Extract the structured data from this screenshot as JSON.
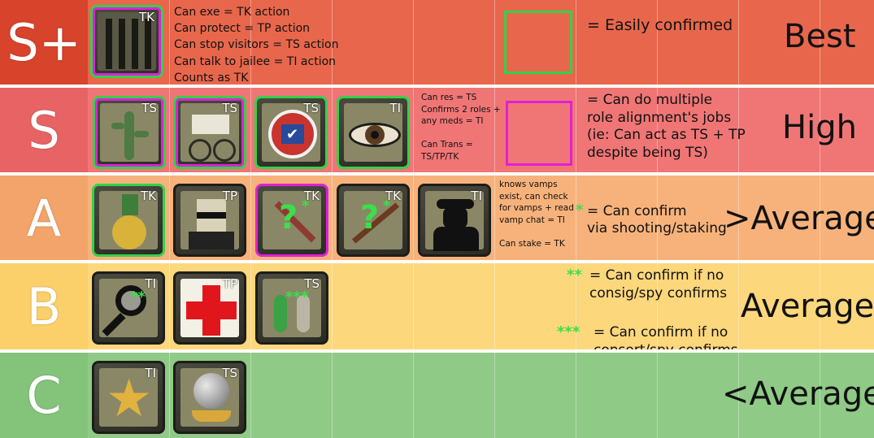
{
  "tiers": [
    {
      "label": "S+",
      "color": "#e8674c",
      "tier_bg": "#d8432b",
      "rank": "Best",
      "icons": [
        {
          "name": "jailor-icon",
          "tag": "TK",
          "border": "gm"
        }
      ],
      "notes": [
        "Can exe = TK action",
        "Can protect = TP action",
        "Can stop visitors = TS action",
        "Can talk to jailee = TI action",
        "Counts as TK"
      ]
    },
    {
      "label": "S",
      "color": "#f07676",
      "tier_bg": "#e86464",
      "rank": "High",
      "icons": [
        {
          "name": "cactus-icon",
          "tag": "TS",
          "border": "gm"
        },
        {
          "name": "transporter-icon",
          "tag": "TS",
          "border": "gm"
        },
        {
          "name": "mayor-vote-icon",
          "tag": "TS",
          "border": "g"
        },
        {
          "name": "eye-icon",
          "tag": "TI",
          "border": "g"
        }
      ],
      "notes": [
        "Can res = TS",
        "Confirms 2 roles +",
        "any meds = TI",
        "",
        "Can Trans =",
        "TS/TP/TK"
      ]
    },
    {
      "label": "A",
      "color": "#f7b27b",
      "tier_bg": "#f3a46a",
      "rank": ">Average",
      "icons": [
        {
          "name": "medal-icon",
          "tag": "TK",
          "border": "g"
        },
        {
          "name": "bodyguard-icon",
          "tag": "TP",
          "border": ""
        },
        {
          "name": "sword-icon",
          "tag": "TK",
          "border": "m"
        },
        {
          "name": "rifle-icon",
          "tag": "TK",
          "border": ""
        },
        {
          "name": "spy-silhouette-icon",
          "tag": "TI",
          "border": ""
        }
      ],
      "notes": [
        "knows vamps",
        "exist, can check",
        "for vamps + read",
        "vamp chat = TI",
        "",
        "Can stake = TK"
      ]
    },
    {
      "label": "B",
      "color": "#fcd77c",
      "tier_bg": "#fbd06a",
      "rank": "Average",
      "icons": [
        {
          "name": "magnifier-icon",
          "tag": "TI",
          "border": ""
        },
        {
          "name": "red-cross-icon",
          "tag": "TP",
          "border": ""
        },
        {
          "name": "walkers-icon",
          "tag": "TS",
          "border": ""
        }
      ],
      "notes": []
    },
    {
      "label": "C",
      "color": "#8fca86",
      "tier_bg": "#84c47a",
      "rank": "<Average",
      "icons": [
        {
          "name": "sheriff-star-icon",
          "tag": "TI",
          "border": ""
        },
        {
          "name": "crystal-ball-icon",
          "tag": "TS",
          "border": ""
        }
      ],
      "notes": []
    }
  ],
  "legend": {
    "green": "= Easily confirmed",
    "magenta_lines": [
      "= Can do multiple",
      "role alignment's jobs",
      "(ie: Can act as TS + TP",
      "despite being TS)"
    ],
    "star1_mark": "*",
    "star1_lines": [
      "= Can confirm",
      "via shooting/staking"
    ],
    "star2_mark": "**",
    "star2_lines": [
      "= Can confirm if no",
      "consig/spy confirms"
    ],
    "star3_mark": "***",
    "star3_lines": [
      "= Can confirm if no",
      "consort/spy confirms"
    ],
    "green_color": "#32d24a",
    "magenta_color": "#e020d8"
  }
}
